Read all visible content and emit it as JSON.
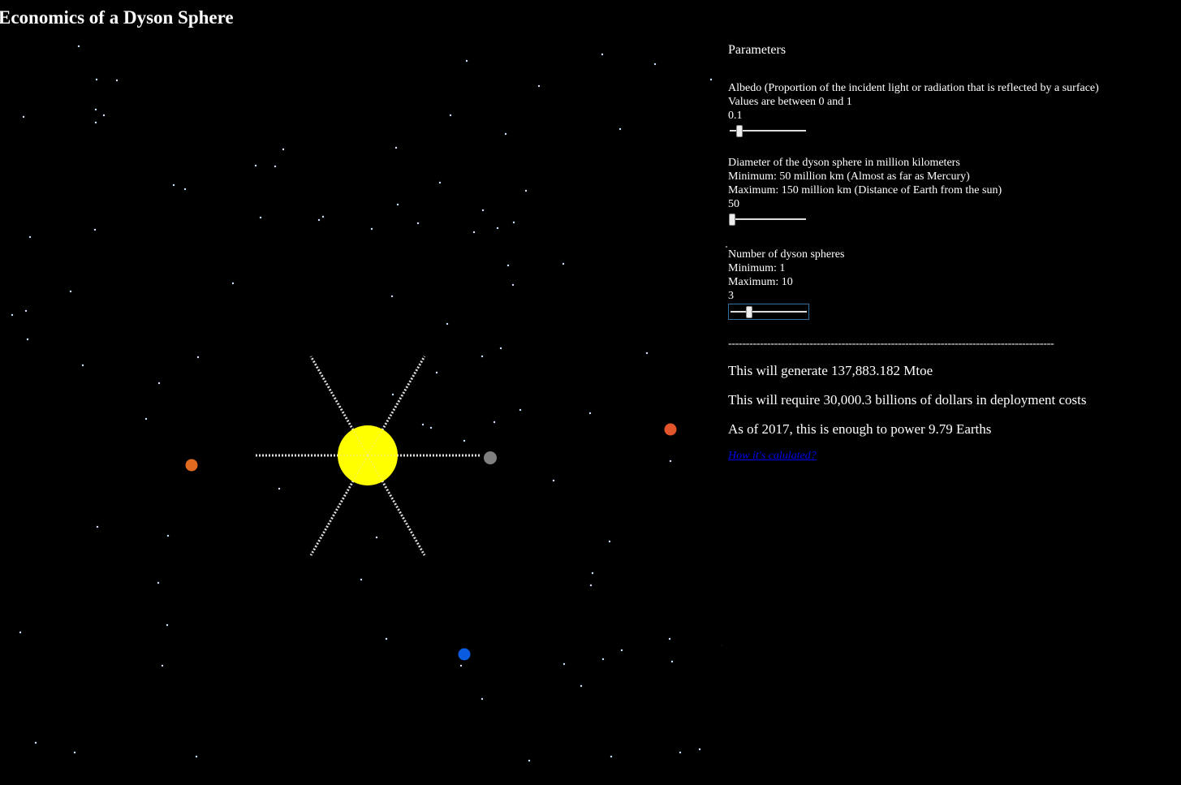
{
  "page": {
    "title": "Economics of a Dyson Sphere"
  },
  "colors": {
    "sun": "#ffff00",
    "mercury": "#808080",
    "venus": "#e06a1f",
    "earth": "#0a5be0",
    "mars": "#e2542a",
    "star": "#cfe3ff",
    "link": "#0000ee"
  },
  "scene": {
    "bodies": [
      {
        "name": "sun",
        "color": "#ffff00"
      },
      {
        "name": "mercury",
        "color": "#808080"
      },
      {
        "name": "venus",
        "color": "#e06a1f"
      },
      {
        "name": "earth",
        "color": "#0a5be0"
      },
      {
        "name": "mars",
        "color": "#e2542a"
      }
    ]
  },
  "parameters": {
    "heading": "Parameters",
    "albedo": {
      "label": "Albedo (Proportion of the incident light or radiation that is reflected by a surface)",
      "range_text": "Values are between 0 and 1",
      "value": "0.1",
      "min": 0,
      "max": 1,
      "current": 0.1
    },
    "diameter": {
      "label": "Diameter of the dyson sphere in million kilometers",
      "min_text": "Minimum: 50 million km (Almost as far as Mercury)",
      "max_text": "Maximum: 150 million km (Distance of Earth from the sun)",
      "value": "50",
      "min": 50,
      "max": 150,
      "current": 50
    },
    "count": {
      "label": "Number of dyson spheres",
      "min_text": "Minimum: 1",
      "max_text": "Maximum: 10",
      "value": "3",
      "min": 1,
      "max": 10,
      "current": 3
    }
  },
  "results": {
    "divider": "--------------------------------------------------------------------------------------------",
    "energy": "This will generate 137,883.182 Mtoe",
    "cost": "This will require 30,000.3 billions of dollars in deployment costs",
    "earths": "As of 2017, this is enough to power 9.79 Earths",
    "link": "How it's calulated?"
  }
}
